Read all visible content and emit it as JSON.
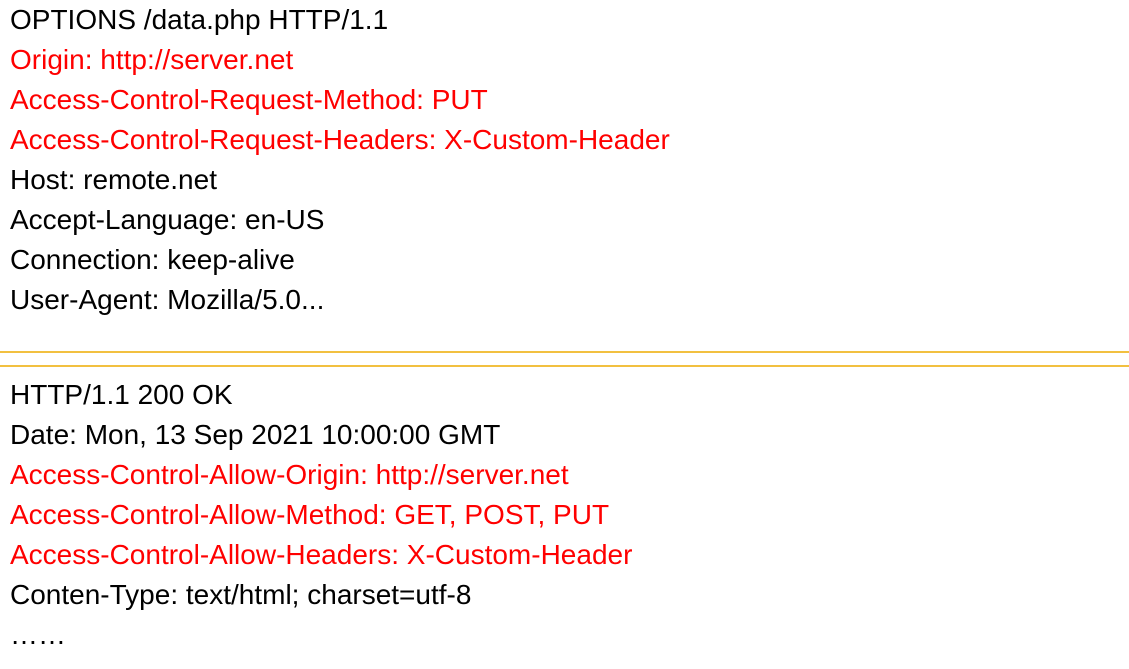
{
  "request": {
    "lines": [
      {
        "text": "OPTIONS /data.php HTTP/1.1",
        "highlight": false
      },
      {
        "text": "Origin: http://server.net",
        "highlight": true
      },
      {
        "text": "Access-Control-Request-Method: PUT",
        "highlight": true
      },
      {
        "text": "Access-Control-Request-Headers: X-Custom-Header",
        "highlight": true
      },
      {
        "text": "Host: remote.net",
        "highlight": false
      },
      {
        "text": "Accept-Language: en-US",
        "highlight": false
      },
      {
        "text": "Connection: keep-alive",
        "highlight": false
      },
      {
        "text": "User-Agent: Mozilla/5.0...",
        "highlight": false
      }
    ]
  },
  "response": {
    "lines": [
      {
        "text": "HTTP/1.1 200 OK",
        "highlight": false
      },
      {
        "text": "Date: Mon, 13 Sep 2021 10:00:00 GMT",
        "highlight": false
      },
      {
        "text": "Access-Control-Allow-Origin: http://server.net",
        "highlight": true
      },
      {
        "text": "Access-Control-Allow-Method: GET, POST, PUT",
        "highlight": true
      },
      {
        "text": "Access-Control-Allow-Headers: X-Custom-Header",
        "highlight": true
      },
      {
        "text": "Conten-Type: text/html; charset=utf-8",
        "highlight": false
      },
      {
        "text": "……",
        "highlight": false
      }
    ]
  },
  "colors": {
    "highlight": "#ff0000",
    "normal": "#000000",
    "divider": "#f2c040"
  }
}
